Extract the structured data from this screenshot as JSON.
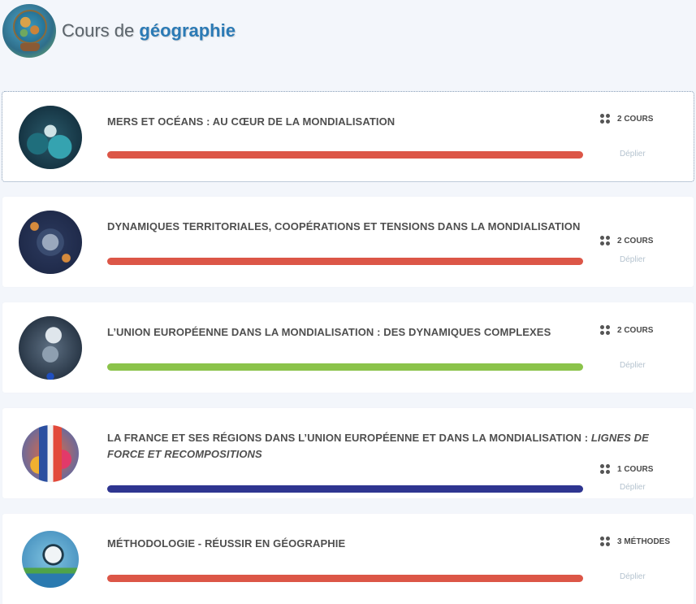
{
  "header": {
    "logo_icon": "globe-icon",
    "title_prefix": "Cours de ",
    "title_accent": "géographie"
  },
  "colors": {
    "red": "#dc5647",
    "green": "#8bc34a",
    "navy": "#2e3590",
    "accent": "#2b7ab5"
  },
  "chapters": [
    {
      "title": "MERS ET OCÉANS : AU CŒUR DE LA MONDIALISATION",
      "title_italic": "",
      "count_label": "2 COURS",
      "unfold_label": "Déplier",
      "progress": 1.0,
      "color": "#dc5647",
      "thumb_icon": "oceans-illustration-icon"
    },
    {
      "title": "DYNAMIQUES TERRITORIALES, COOPÉRATIONS ET TENSIONS DANS LA MONDIALISATION",
      "title_italic": "",
      "count_label": "2 COURS",
      "unfold_label": "Déplier",
      "progress": 1.0,
      "color": "#dc5647",
      "thumb_icon": "world-network-illustration-icon"
    },
    {
      "title": "L’UNION EUROPÉENNE DANS LA MONDIALISATION : DES DYNAMIQUES COMPLEXES",
      "title_italic": "",
      "count_label": "2 COURS",
      "unfold_label": "Déplier",
      "progress": 1.0,
      "color": "#8bc34a",
      "thumb_icon": "european-union-illustration-icon"
    },
    {
      "title": "LA FRANCE ET SES RÉGIONS DANS L’UNION EUROPÉENNE ET DANS LA MONDIALISATION : ",
      "title_italic": "LIGNES DE FORCE ET RECOMPOSITIONS",
      "count_label": "1 COURS",
      "unfold_label": "Déplier",
      "progress": 1.0,
      "color": "#2e3590",
      "thumb_icon": "france-regions-illustration-icon"
    },
    {
      "title": "MÉTHODOLOGIE - RÉUSSIR EN GÉOGRAPHIE",
      "title_italic": "",
      "count_label": "3 MÉTHODES",
      "unfold_label": "Déplier",
      "progress": 1.0,
      "color": "#dc5647",
      "thumb_icon": "magnifier-landscape-icon"
    }
  ]
}
